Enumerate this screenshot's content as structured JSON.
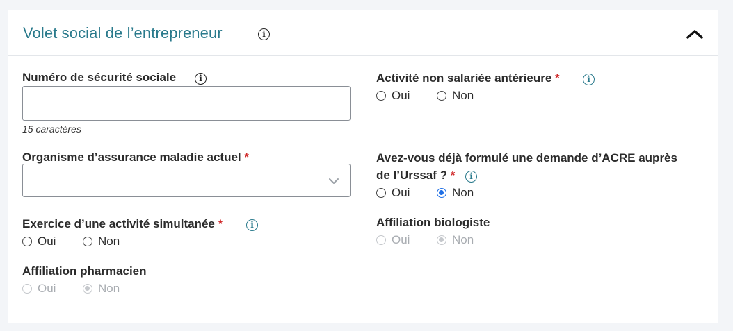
{
  "section": {
    "title": "Volet social de l’entrepreneur",
    "collapse_icon": "chevron-up-icon"
  },
  "fields": {
    "ssn": {
      "label": "Numéro de sécurité sociale",
      "value": "",
      "hint": "15 caractères"
    },
    "prior_activity": {
      "label": "Activité non salariée antérieure",
      "required_mark": "*",
      "options": [
        "Oui",
        "Non"
      ],
      "selected": null
    },
    "health_insurance": {
      "label": "Organisme d’assurance maladie actuel",
      "required_mark": "*",
      "selected_value": ""
    },
    "acre": {
      "label_line1": "Avez-vous déjà formulé une demande d’ACRE auprès",
      "label_line2": "de l’Urssaf ?",
      "required_mark": "*",
      "options": [
        "Oui",
        "Non"
      ],
      "selected": "Non"
    },
    "simultaneous": {
      "label": "Exercice d’une activité simultanée",
      "required_mark": "*",
      "options": [
        "Oui",
        "Non"
      ],
      "selected": null
    },
    "biologist": {
      "label": "Affiliation biologiste",
      "options": [
        "Oui",
        "Non"
      ],
      "selected": "Non",
      "disabled": true
    },
    "pharmacist": {
      "label": "Affiliation pharmacien",
      "options": [
        "Oui",
        "Non"
      ],
      "selected": "Non",
      "disabled": true
    }
  },
  "info_icon_glyph": "i"
}
